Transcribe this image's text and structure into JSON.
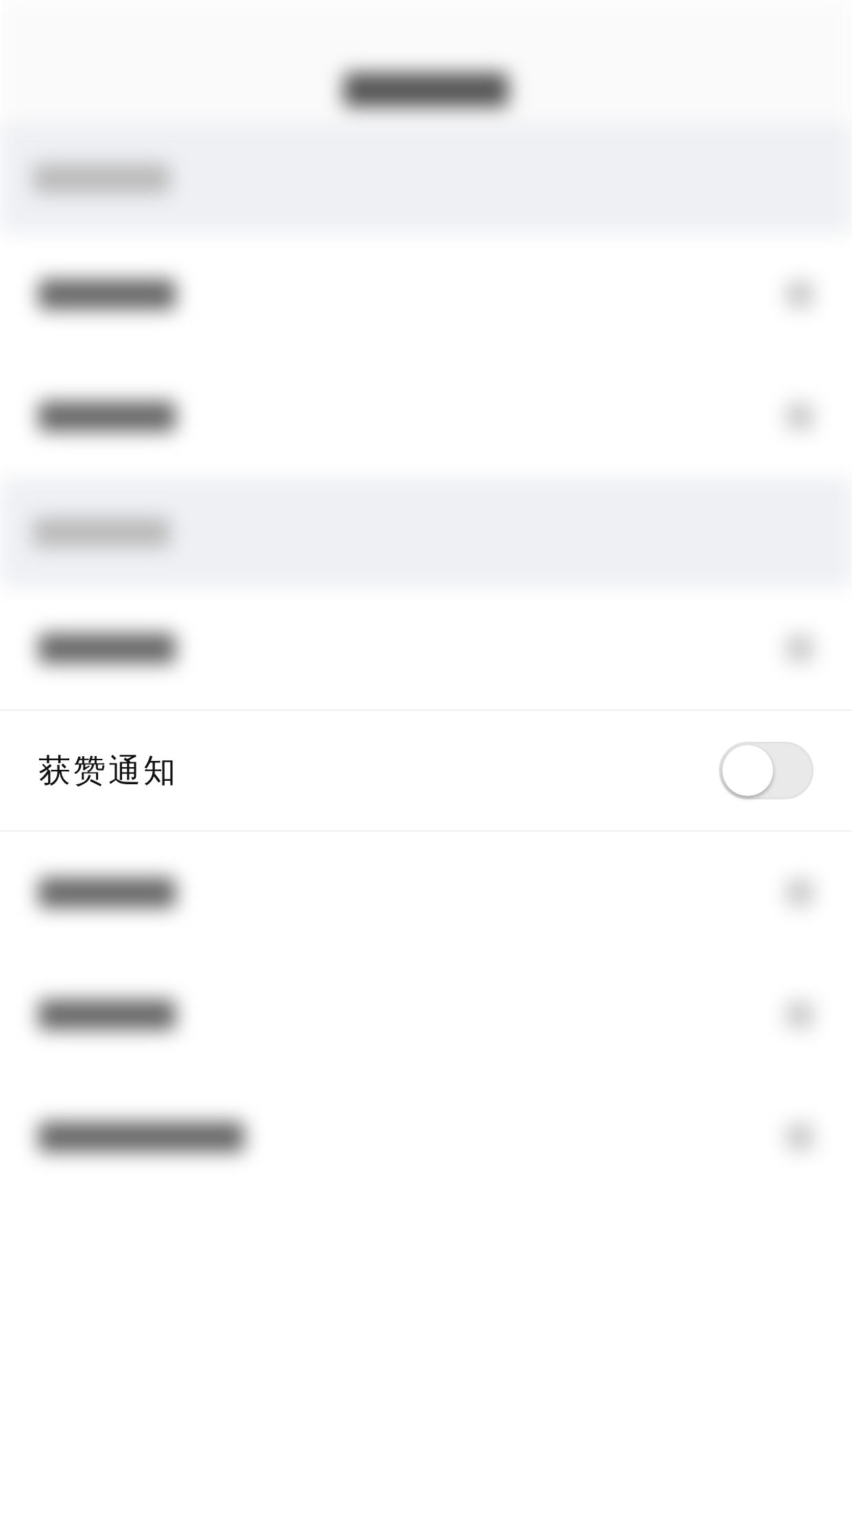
{
  "notification_row": {
    "label": "获赞通知",
    "on": false
  }
}
